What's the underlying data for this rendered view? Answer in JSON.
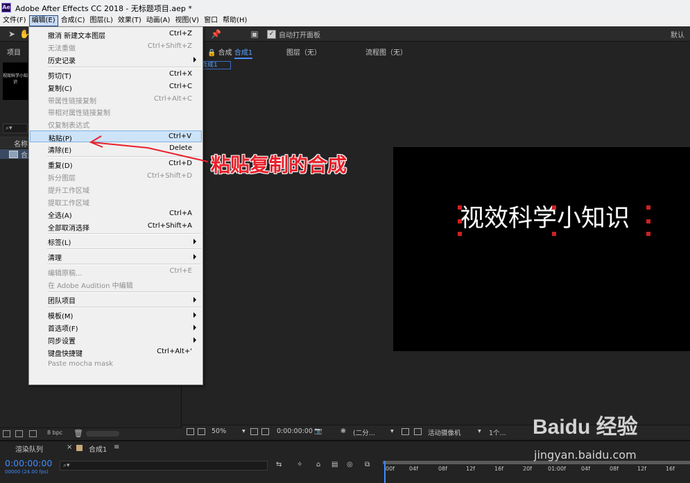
{
  "window": {
    "title": "Adobe After Effects CC 2018 - 无标题项目.aep *",
    "app_icon": "Ae"
  },
  "menubar": [
    "文件(F)",
    "编辑(E)",
    "合成(C)",
    "图层(L)",
    "效果(T)",
    "动画(A)",
    "视图(V)",
    "窗口",
    "帮助(H)"
  ],
  "toolbar": {
    "auto_open_label": "自动打开面板",
    "workspace": "默认"
  },
  "project": {
    "tab": "项目",
    "thumb_text": "视效科学小知识",
    "col_name": "名称",
    "item_label": "合成",
    "bpc": "8 bpc"
  },
  "viewer": {
    "tab_comp_prefix": "合成",
    "tab_comp_name": "合成1",
    "tab_layer": "图层（无）",
    "tab_flow": "流程图（无）",
    "breadcrumb": "合成1",
    "canvas_text": "视效科学小知识",
    "zoom": "50%",
    "timecode": "0:00:00:00",
    "resolution": "(二分...",
    "camera": "活动摄像机",
    "views": "1个..."
  },
  "timeline": {
    "render_queue": "渲染队列",
    "comp_tab": "合成1",
    "timecode": "0:00:00:00",
    "timecode_sub": "00000 (24.00 fps)",
    "ticks": [
      "00f",
      "04f",
      "08f",
      "12f",
      "16f",
      "20f",
      "01:00f",
      "04f",
      "08f",
      "12f",
      "16f"
    ]
  },
  "edit_menu": [
    {
      "label": "撤消 新建文本图层",
      "key": "Ctrl+Z"
    },
    {
      "label": "无法重做",
      "key": "Ctrl+Shift+Z",
      "disabled": true
    },
    {
      "label": "历史记录",
      "sub": true
    },
    {
      "sep": true
    },
    {
      "label": "剪切(T)",
      "key": "Ctrl+X"
    },
    {
      "label": "复制(C)",
      "key": "Ctrl+C"
    },
    {
      "label": "带属性链接复制",
      "key": "Ctrl+Alt+C",
      "disabled": true
    },
    {
      "label": "带相对属性链接复制",
      "disabled": true
    },
    {
      "label": "仅复制表达式",
      "disabled": true
    },
    {
      "label": "粘贴(P)",
      "key": "Ctrl+V",
      "highlight": true
    },
    {
      "label": "清除(E)",
      "key": "Delete"
    },
    {
      "sep": true
    },
    {
      "label": "重复(D)",
      "key": "Ctrl+D"
    },
    {
      "label": "拆分图层",
      "key": "Ctrl+Shift+D",
      "disabled": true
    },
    {
      "label": "提升工作区域",
      "disabled": true
    },
    {
      "label": "提取工作区域",
      "disabled": true
    },
    {
      "label": "全选(A)",
      "key": "Ctrl+A"
    },
    {
      "label": "全部取消选择",
      "key": "Ctrl+Shift+A"
    },
    {
      "sep": true
    },
    {
      "label": "标签(L)",
      "sub": true
    },
    {
      "sep": true
    },
    {
      "label": "清理",
      "sub": true
    },
    {
      "sep": true
    },
    {
      "label": "编辑原稿...",
      "key": "Ctrl+E",
      "disabled": true
    },
    {
      "label": "在 Adobe Audition 中编辑",
      "disabled": true
    },
    {
      "sep": true
    },
    {
      "label": "团队项目",
      "sub": true
    },
    {
      "sep": true
    },
    {
      "label": "模板(M)",
      "sub": true
    },
    {
      "label": "首选项(F)",
      "sub": true
    },
    {
      "label": "同步设置",
      "sub": true
    },
    {
      "label": "键盘快捷键",
      "key": "Ctrl+Alt+'"
    },
    {
      "label": "Paste mocha mask",
      "disabled": true
    }
  ],
  "annotation": "粘贴复制的合成",
  "watermark": {
    "logo": "Baidu 经验",
    "url": "jingyan.baidu.com"
  }
}
